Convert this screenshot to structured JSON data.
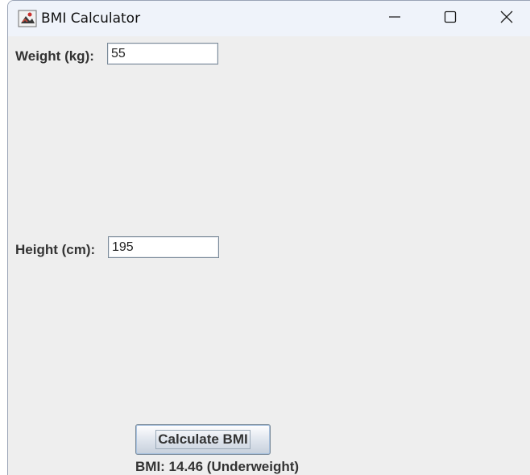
{
  "window": {
    "title": "BMI Calculator",
    "icon": "java-app-icon"
  },
  "form": {
    "weight_label": "Weight (kg):",
    "weight_value": "55",
    "height_label": "Height (cm):",
    "height_value": "195",
    "calculate_label": "Calculate BMI",
    "result_text": "BMI: 14.46 (Underweight)"
  }
}
